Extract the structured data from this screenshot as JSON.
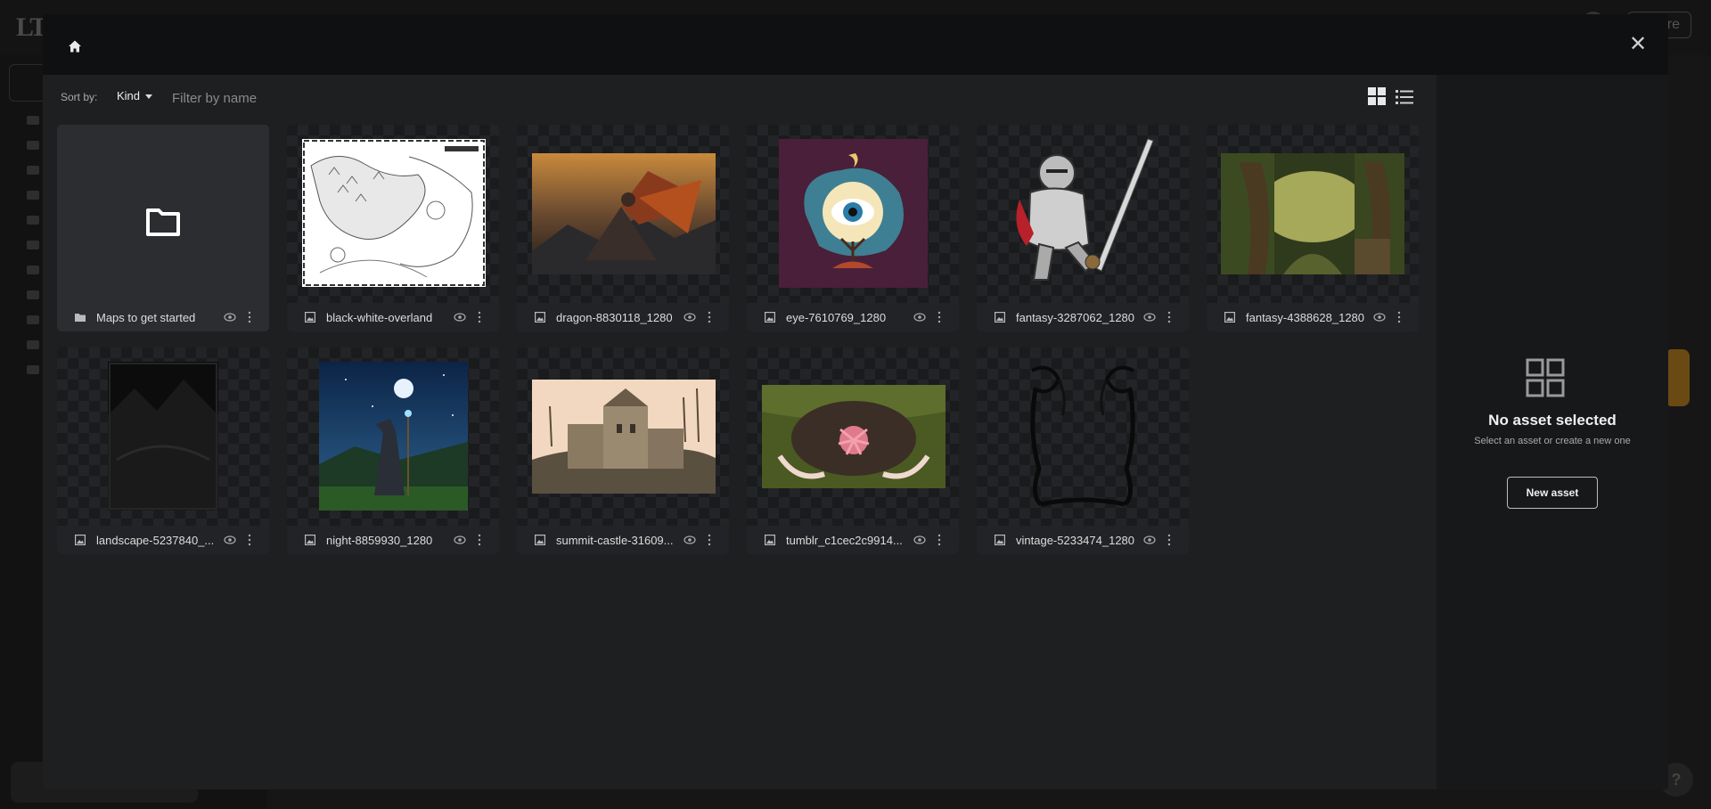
{
  "background": {
    "topbar_button": "re",
    "help": "?"
  },
  "toolbar": {
    "sort_label": "Sort by:",
    "sort_value": "Kind",
    "filter_placeholder": "Filter by name",
    "view_grid_icon": "grid-view-icon",
    "view_list_icon": "list-view-icon"
  },
  "assets": [
    {
      "name": "Maps to get started",
      "kind": "folder"
    },
    {
      "name": "black-white-overland",
      "kind": "image"
    },
    {
      "name": "dragon-8830118_1280",
      "kind": "image"
    },
    {
      "name": "eye-7610769_1280",
      "kind": "image"
    },
    {
      "name": "fantasy-3287062_1280",
      "kind": "image"
    },
    {
      "name": "fantasy-4388628_1280",
      "kind": "image"
    },
    {
      "name": "landscape-5237840_...",
      "kind": "image"
    },
    {
      "name": "night-8859930_1280",
      "kind": "image"
    },
    {
      "name": "summit-castle-31609...",
      "kind": "image"
    },
    {
      "name": "tumblr_c1cec2c9914...",
      "kind": "image"
    },
    {
      "name": "vintage-5233474_1280",
      "kind": "image"
    }
  ],
  "panel": {
    "title": "No asset selected",
    "subtitle": "Select an asset or create a new one",
    "button": "New asset"
  },
  "colors": {
    "modal_bg": "#1e1f21",
    "header_bg": "#0f1011",
    "panel_bg": "#17181a"
  }
}
